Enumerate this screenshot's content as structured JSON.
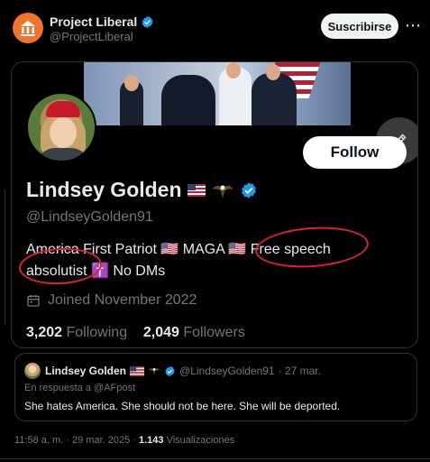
{
  "post": {
    "author_name": "Project Liberal",
    "author_handle": "@ProjectLiberal",
    "subscribe_label": "Suscribirse",
    "more_label": "⋯"
  },
  "profile": {
    "name": "Lindsey Golden",
    "handle": "@LindseyGolden91",
    "follow_label": "Follow",
    "bio_line1": "America First Patriot 🇺🇸 MAGA 🇺🇸 Free speech",
    "bio_line2": "absolutist ✝️ No DMs",
    "joined": "Joined November 2022",
    "following_count": "3,202",
    "following_label": "Following",
    "followers_count": "2,049",
    "followers_label": "Followers"
  },
  "quote": {
    "name": "Lindsey Golden",
    "handle": "@LindseyGolden91",
    "date": "· 27 mar.",
    "reply_to": "En respuesta a @AFpost",
    "text": "She hates America. She should not be here. She will be deported."
  },
  "meta": {
    "time": "11:58 a. m.",
    "date": "· 29 mar. 2025 ·",
    "views_count": "1.143",
    "views_label": "Visualizaciones"
  },
  "colors": {
    "accent": "#1d9bf0",
    "annotation": "#e0202a",
    "logo": "#f0742d"
  }
}
